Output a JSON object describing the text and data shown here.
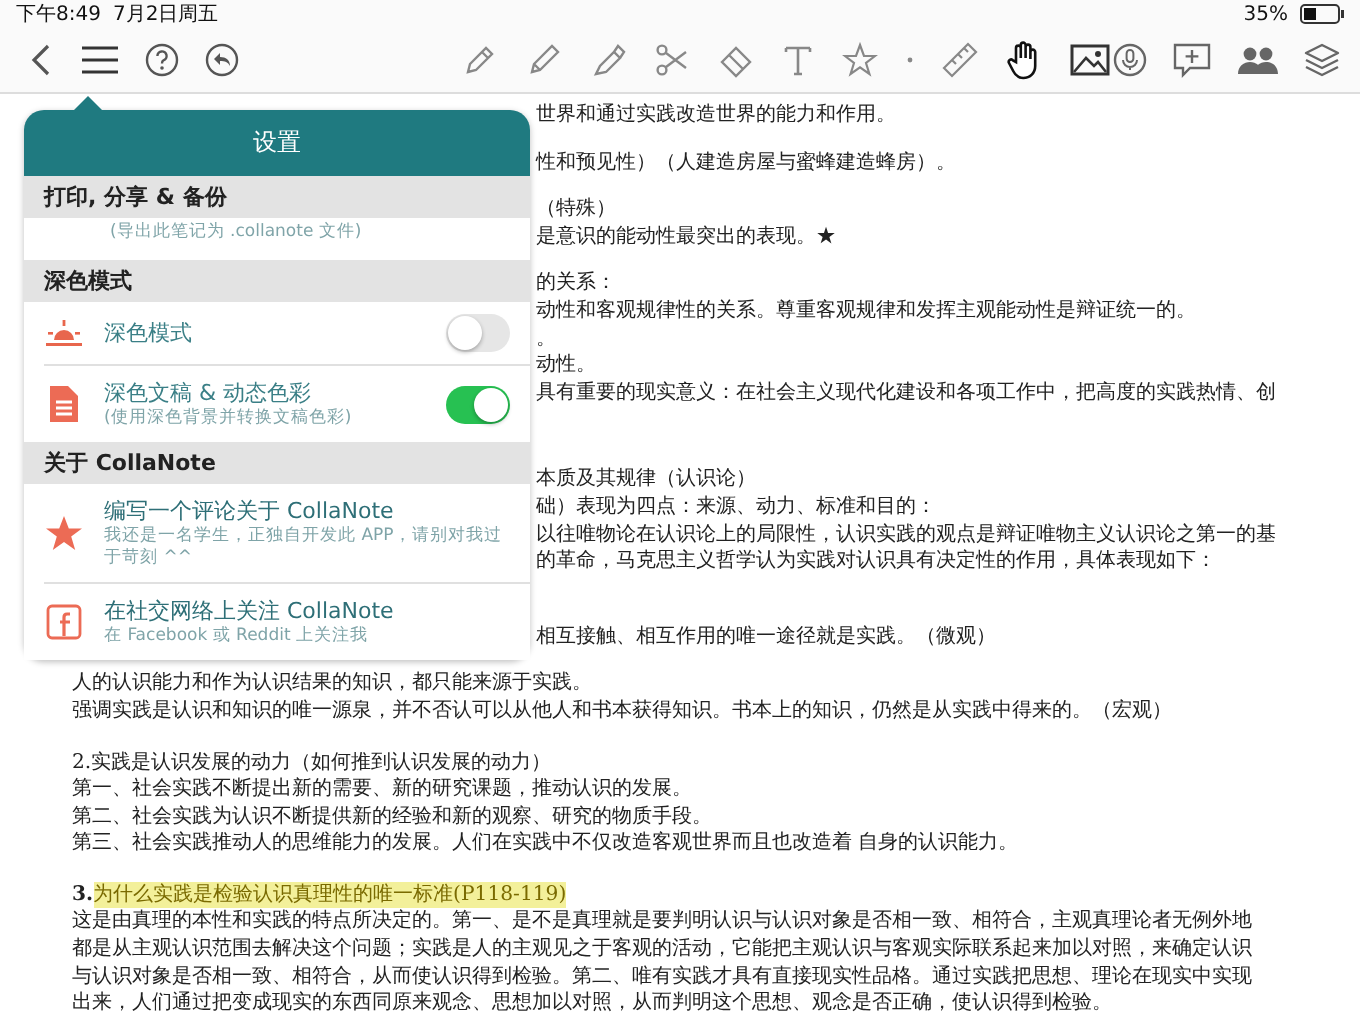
{
  "status_bar": {
    "time": "下午8:49",
    "date": "7月2日周五",
    "battery": "35%"
  },
  "toolbar": {
    "left": [
      {
        "kind": "back"
      },
      {
        "kind": "menu",
        "selected": true
      },
      {
        "kind": "help"
      },
      {
        "kind": "undo"
      }
    ],
    "tools": [
      {
        "kind": "pen",
        "selected": false
      },
      {
        "kind": "pencil",
        "selected": false
      },
      {
        "kind": "highlighter",
        "selected": false
      },
      {
        "kind": "scissors",
        "selected": false
      },
      {
        "kind": "eraser",
        "selected": false
      },
      {
        "kind": "text",
        "selected": false
      },
      {
        "kind": "star",
        "selected": false
      },
      {
        "kind": "dot",
        "selected": false
      },
      {
        "kind": "ruler",
        "selected": false
      },
      {
        "kind": "hand",
        "selected": true
      },
      {
        "kind": "image",
        "selected": false
      }
    ],
    "right": [
      {
        "kind": "mic"
      },
      {
        "kind": "comment"
      },
      {
        "kind": "people"
      },
      {
        "kind": "layers"
      }
    ]
  },
  "settings": {
    "title": "设置",
    "sections": [
      {
        "header": "打印, 分享 & 备份",
        "rows": [
          {
            "kind": "partial",
            "subtitle": "(导出此笔记为 .collanote 文件)"
          }
        ]
      },
      {
        "header": "深色模式",
        "rows": [
          {
            "kind": "toggle",
            "label": "深色模式",
            "on": false
          },
          {
            "kind": "toggle",
            "label": "深色文稿 & 动态色彩",
            "subtitle": "(使用深色背景并转换文稿色彩)",
            "on": true
          }
        ]
      },
      {
        "header": "关于 CollaNote",
        "rows": [
          {
            "kind": "link",
            "label": "编写一个评论关于 CollaNote",
            "subtitle": "我还是一名学生，正独自开发此 APP，请别对我过于苛刻 ^^"
          },
          {
            "kind": "link",
            "label": "在社交网络上关注 CollaNote",
            "subtitle": "在 Facebook 或 Reddit 上关注我"
          }
        ]
      }
    ]
  },
  "document": {
    "paragraphs": [
      {
        "kind": "partial",
        "lines": [
          "世界和通过实践改造世界的能力和作用。"
        ]
      },
      {
        "kind": "partial",
        "lines": [
          "性和预见性）（人建造房屋与蜜蜂建造蜂房）。"
        ]
      },
      {
        "kind": "partial",
        "lines": [
          "（特殊）",
          "是意识的能动性最突出的表现。★"
        ]
      },
      {
        "kind": "partial",
        "lines": [
          "的关系：",
          "动性和客观规律性的关系。尊重客观规律和发挥主观能动性是辩证统一的。",
          "。",
          "动性。",
          "具有重要的现实意义：在社会主义现代化建设和各项工作中，把高度的实践热情、创"
        ]
      },
      {
        "kind": "partial-far",
        "lines": [
          "本质及其规律（认识论）",
          "础）表现为四点：来源、动力、标准和目的：",
          "以往唯物论在认识论上的局限性，认识实践的观点是辩证唯物主义认识论之第一的基",
          "的革命，马克思主义哲学认为实践对认识具有决定性的作用，具体表现如下："
        ]
      },
      {
        "kind": "partial-far",
        "lines": [
          "相互接触、相互作用的唯一途径就是实践。（微观）"
        ]
      },
      {
        "kind": "full",
        "lines": [
          "人的认识能力和作为认识结果的知识，都只能来源于实践。",
          "强调实践是认识和知识的唯一源泉，并不否认可以从他人和书本获得知识。书本上的知识，仍然是从实践中得来的。（宏观）"
        ]
      },
      {
        "kind": "full-gap",
        "lines": [
          "2.实践是认识发展的动力（如何推到认识发展的动力）",
          "第一、社会实践不断提出新的需要、新的研究课题，推动认识的发展。",
          "第二、社会实践为认识不断提供新的经验和新的观察、研究的物质手段。",
          "第三、社会实践推动人的思维能力的发展。人们在实践中不仅改造客观世界而且也改造着 自身的认识能力。"
        ]
      },
      {
        "kind": "heading",
        "number": "3.",
        "text": "为什么实践是检验认识真理性的唯一标准(P118-119)",
        "highlighted": true
      },
      {
        "kind": "full",
        "lines": [
          "这是由真理的本性和实践的特点所决定的。第一、是不是真理就是要判明认识与认识对象是否相一致、相符合，主观真理论者无例外地",
          "都是从主观认识范围去解决这个问题；实践是人的主观见之于客观的活动，它能把主观认识与客观实际联系起来加以对照，来确定认识",
          "与认识对象是否相一致、相符合，从而使认识得到检验。第二、唯有实践才具有直接现实性品格。通过实践把思想、理论在现实中实现",
          "出来，人们通过把变成现实的东西同原来观念、思想加以对照，从而判明这个思想、观念是否正确，使认识得到检验。"
        ]
      }
    ]
  }
}
